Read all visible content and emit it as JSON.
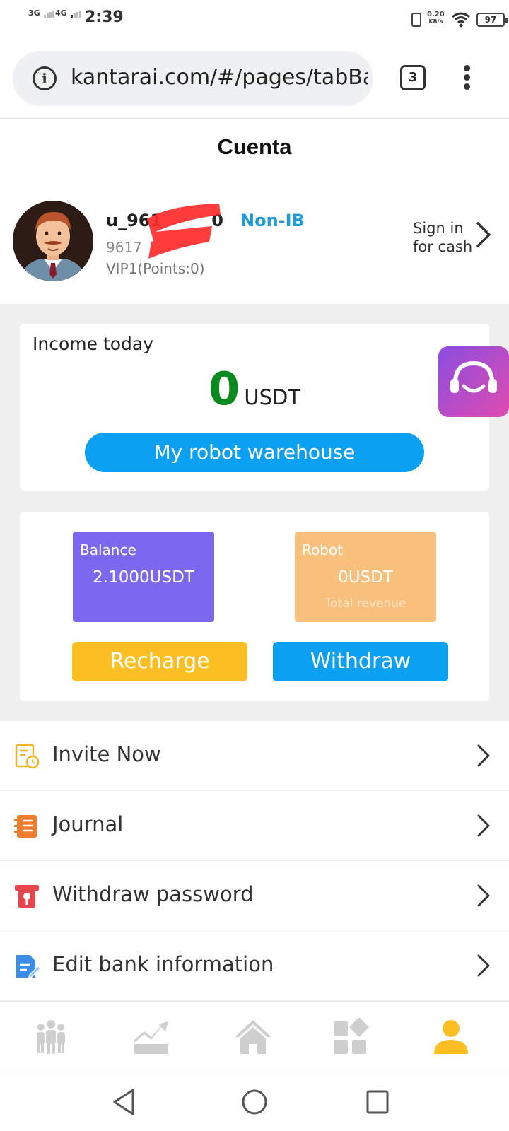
{
  "status_bar": {
    "signal_1": "3G",
    "signal_2": "4G",
    "time": "2:39",
    "net_speed": "0.20",
    "net_unit": "KB/s",
    "battery": "97"
  },
  "browser": {
    "url": "kantarai.com/#/pages/tabBa",
    "tab_count": "3"
  },
  "page": {
    "title": "Cuenta"
  },
  "profile": {
    "username": "u_961",
    "username_tail": "0",
    "account_type": "Non-IB",
    "uid": "9617",
    "vip": "VIP1(Points:0)",
    "sign_in": "Sign in for cash"
  },
  "income": {
    "label": "Income today",
    "value": "0",
    "unit": "USDT",
    "warehouse_button": "My robot warehouse"
  },
  "wallet": {
    "balance_label": "Balance",
    "balance_value": "2.1000USDT",
    "robot_label": "Robot",
    "robot_value": "0USDT",
    "robot_sub": "Total revenue",
    "recharge_button": "Recharge",
    "withdraw_button": "Withdraw"
  },
  "menu": [
    {
      "label": "Invite Now",
      "icon": "invite-icon"
    },
    {
      "label": "Journal",
      "icon": "journal-icon"
    },
    {
      "label": "Withdraw password",
      "icon": "password-icon"
    },
    {
      "label": "Edit bank information",
      "icon": "bank-edit-icon"
    }
  ],
  "bottom_nav": [
    {
      "icon": "team-icon"
    },
    {
      "icon": "chart-icon"
    },
    {
      "icon": "home-icon"
    },
    {
      "icon": "apps-icon"
    },
    {
      "icon": "user-icon",
      "active": true
    }
  ],
  "colors": {
    "accent_blue": "#0ba0f2",
    "income_green": "#0a8a1f",
    "balance_tile": "#7b68ee",
    "robot_tile": "#f8c07c",
    "recharge": "#fbbf24",
    "active_nav": "#fbbf24",
    "inactive_nav": "#cfcfcf"
  }
}
